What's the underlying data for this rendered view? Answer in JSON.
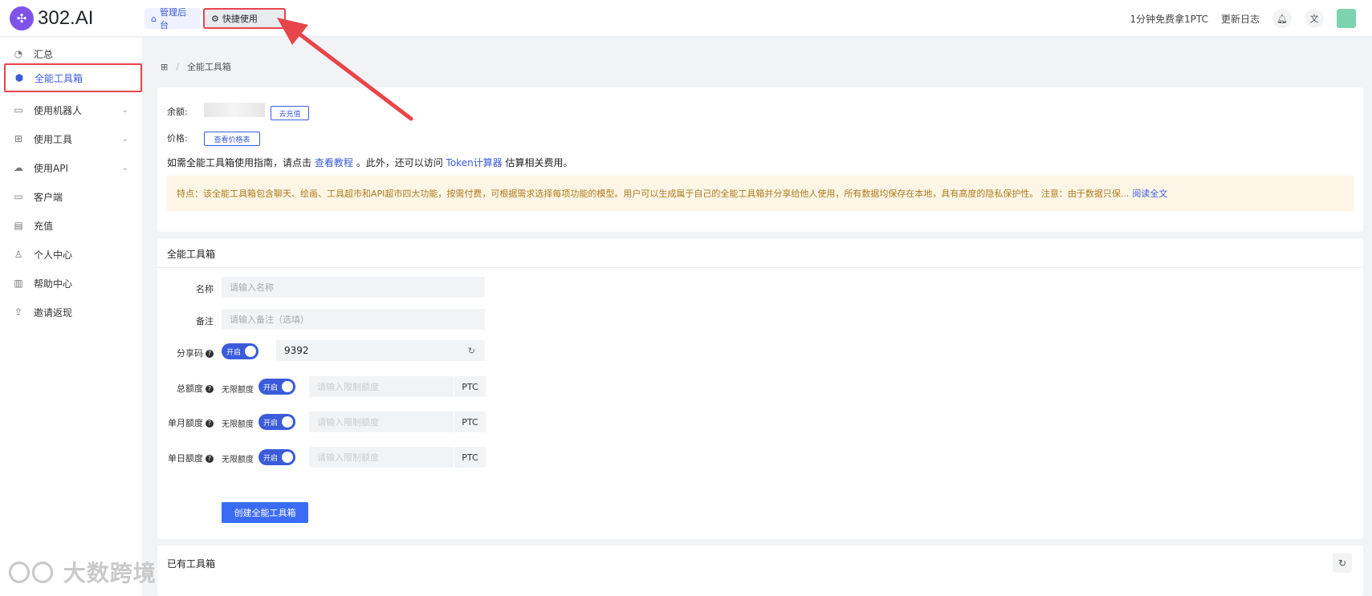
{
  "app": {
    "logo_text": "302.AI"
  },
  "tabs": [
    {
      "label": "管理后台",
      "icon": "home-icon"
    },
    {
      "label": "快捷使用",
      "icon": "gear-icon"
    }
  ],
  "topbar": {
    "promo": "1分钟免费拿1PTC",
    "changelog": "更新日志"
  },
  "sidebar": {
    "items": [
      {
        "label": "汇总",
        "icon": "dashboard-icon"
      },
      {
        "label": "全能工具箱",
        "icon": "cube-icon",
        "active": true
      },
      {
        "label": "使用机器人",
        "icon": "robot-icon",
        "expandable": true
      },
      {
        "label": "使用工具",
        "icon": "grid-icon",
        "expandable": true
      },
      {
        "label": "使用API",
        "icon": "cloud-icon",
        "expandable": true
      },
      {
        "label": "客户端",
        "icon": "monitor-icon"
      },
      {
        "label": "充值",
        "icon": "wallet-icon"
      },
      {
        "label": "个人中心",
        "icon": "user-icon"
      },
      {
        "label": "帮助中心",
        "icon": "book-icon"
      },
      {
        "label": "邀请返现",
        "icon": "invite-icon"
      }
    ]
  },
  "breadcrumb": {
    "current": "全能工具箱"
  },
  "account": {
    "balance_label": "余额:",
    "recharge_button": "去充值",
    "price_label": "价格:",
    "price_button": "查看价格表"
  },
  "guide": {
    "text_1": "如需全能工具箱使用指南，请点击",
    "link_tutorial": "查看教程",
    "text_2": "。此外，还可以访问",
    "link_token": "Token计算器",
    "text_3": "估算相关费用。"
  },
  "notice": {
    "text": "特点：该全能工具箱包含聊天、绘画、工具超市和API超市四大功能，按需付费，可根据需求选择每项功能的模型。用户可以生成属于自己的全能工具箱并分享给他人使用，所有数据均保存在本地，具有高度的隐私保护性。 注意：由于数据只保...",
    "read_more": "阅读全文"
  },
  "form": {
    "title": "全能工具箱",
    "name_label": "名称",
    "name_placeholder": "请输入名称",
    "remark_label": "备注",
    "remark_placeholder": "请输入备注（选填）",
    "share_label": "分享码",
    "share_toggle": "开启",
    "share_code": "9392",
    "total_label": "总额度",
    "monthly_label": "单月额度",
    "daily_label": "单日额度",
    "unlimited_text": "无限额度",
    "toggle_on": "开启",
    "limit_placeholder": "请输入限制额度",
    "unit": "PTC",
    "create_button": "创建全能工具箱"
  },
  "existing": {
    "title": "已有工具箱"
  },
  "watermark": "大数跨境",
  "colors": {
    "accent": "#3b5bdb",
    "highlight": "#e8454a",
    "notice_bg": "#fdf6e6"
  }
}
